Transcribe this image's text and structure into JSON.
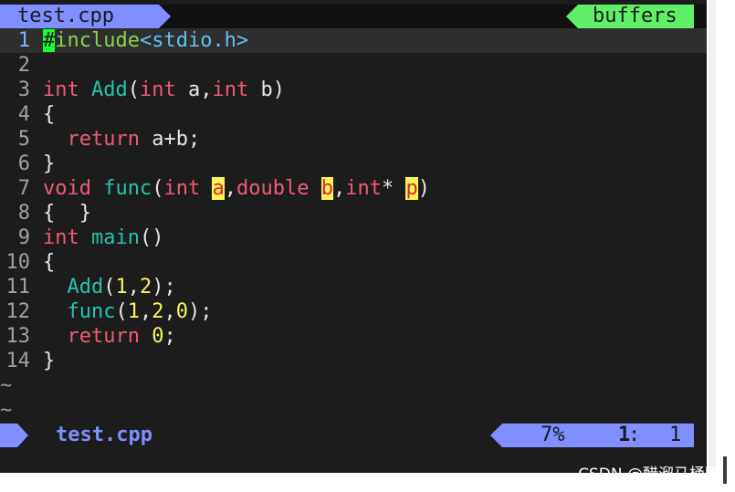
{
  "tabline": {
    "active_tab": "test.cpp",
    "buffers_label": "buffers"
  },
  "editor": {
    "lines": [
      {
        "num": "1",
        "segments": [
          [
            "#",
            "cur"
          ],
          [
            "include",
            "inc"
          ],
          [
            "<stdio.h>",
            "hdr"
          ]
        ]
      },
      {
        "num": "2",
        "segments": []
      },
      {
        "num": "3",
        "segments": [
          [
            "int",
            "kw"
          ],
          [
            " ",
            ""
          ],
          [
            "Add",
            "fn"
          ],
          [
            "(",
            ""
          ],
          [
            "int",
            "kw"
          ],
          [
            " a,",
            ""
          ],
          [
            "int",
            "kw"
          ],
          [
            " b)",
            ""
          ]
        ]
      },
      {
        "num": "4",
        "segments": [
          [
            "{",
            ""
          ]
        ]
      },
      {
        "num": "5",
        "segments": [
          [
            "  ",
            ""
          ],
          [
            "return",
            "kw"
          ],
          [
            " a+b;",
            ""
          ]
        ]
      },
      {
        "num": "6",
        "segments": [
          [
            "}",
            ""
          ]
        ]
      },
      {
        "num": "7",
        "segments": [
          [
            "void",
            "kw"
          ],
          [
            " ",
            ""
          ],
          [
            "func",
            "fn"
          ],
          [
            "(",
            ""
          ],
          [
            "int",
            "kw"
          ],
          [
            " ",
            ""
          ],
          [
            "a",
            "hl"
          ],
          [
            ",",
            ""
          ],
          [
            "double",
            "kw"
          ],
          [
            " ",
            ""
          ],
          [
            "b",
            "hl"
          ],
          [
            ",",
            ""
          ],
          [
            "int",
            "kw"
          ],
          [
            "* ",
            ""
          ],
          [
            "p",
            "hl"
          ],
          [
            ")",
            ""
          ]
        ]
      },
      {
        "num": "8",
        "segments": [
          [
            "{  }",
            ""
          ]
        ]
      },
      {
        "num": "9",
        "segments": [
          [
            "int",
            "kw"
          ],
          [
            " ",
            ""
          ],
          [
            "main",
            "fn"
          ],
          [
            "()",
            ""
          ]
        ]
      },
      {
        "num": "10",
        "segments": [
          [
            "{",
            ""
          ]
        ]
      },
      {
        "num": "11",
        "segments": [
          [
            "  ",
            ""
          ],
          [
            "Add",
            "fn"
          ],
          [
            "(",
            ""
          ],
          [
            "1",
            "num"
          ],
          [
            ",",
            ""
          ],
          [
            "2",
            "num"
          ],
          [
            ");",
            ""
          ]
        ]
      },
      {
        "num": "12",
        "segments": [
          [
            "  ",
            ""
          ],
          [
            "func",
            "fn"
          ],
          [
            "(",
            ""
          ],
          [
            "1",
            "num"
          ],
          [
            ",",
            ""
          ],
          [
            "2",
            "num"
          ],
          [
            ",",
            ""
          ],
          [
            "0",
            "num"
          ],
          [
            ");",
            ""
          ]
        ]
      },
      {
        "num": "13",
        "segments": [
          [
            "  ",
            ""
          ],
          [
            "return",
            "kw"
          ],
          [
            " ",
            ""
          ],
          [
            "0",
            "num"
          ],
          [
            ";",
            ""
          ]
        ]
      },
      {
        "num": "14",
        "segments": [
          [
            "}",
            ""
          ]
        ]
      }
    ],
    "tilde_lines": [
      "~",
      "~"
    ]
  },
  "statusline": {
    "filename": "test.cpp",
    "percent": "7%",
    "line": "1",
    "colon": ":",
    "column": "1"
  },
  "watermark": "CSDN @醋溜马桶圈",
  "colors": {
    "keyword": "#f05b73",
    "function": "#21c4b0",
    "number": "#f7f45d",
    "include": "#8bd150",
    "header": "#5fc2f0",
    "accent": "#7f8fff",
    "buffers": "#5ff067"
  }
}
